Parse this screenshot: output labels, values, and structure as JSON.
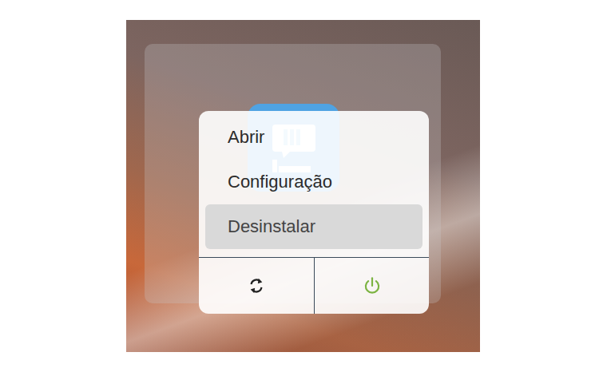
{
  "menu": {
    "items": [
      {
        "label": "Abrir",
        "selected": false
      },
      {
        "label": "Configuração",
        "selected": false
      },
      {
        "label": "Desinstalar",
        "selected": true
      }
    ]
  },
  "actions": [
    {
      "kind": "refresh",
      "color": "#222222"
    },
    {
      "kind": "power",
      "color": "#7cb342"
    }
  ]
}
